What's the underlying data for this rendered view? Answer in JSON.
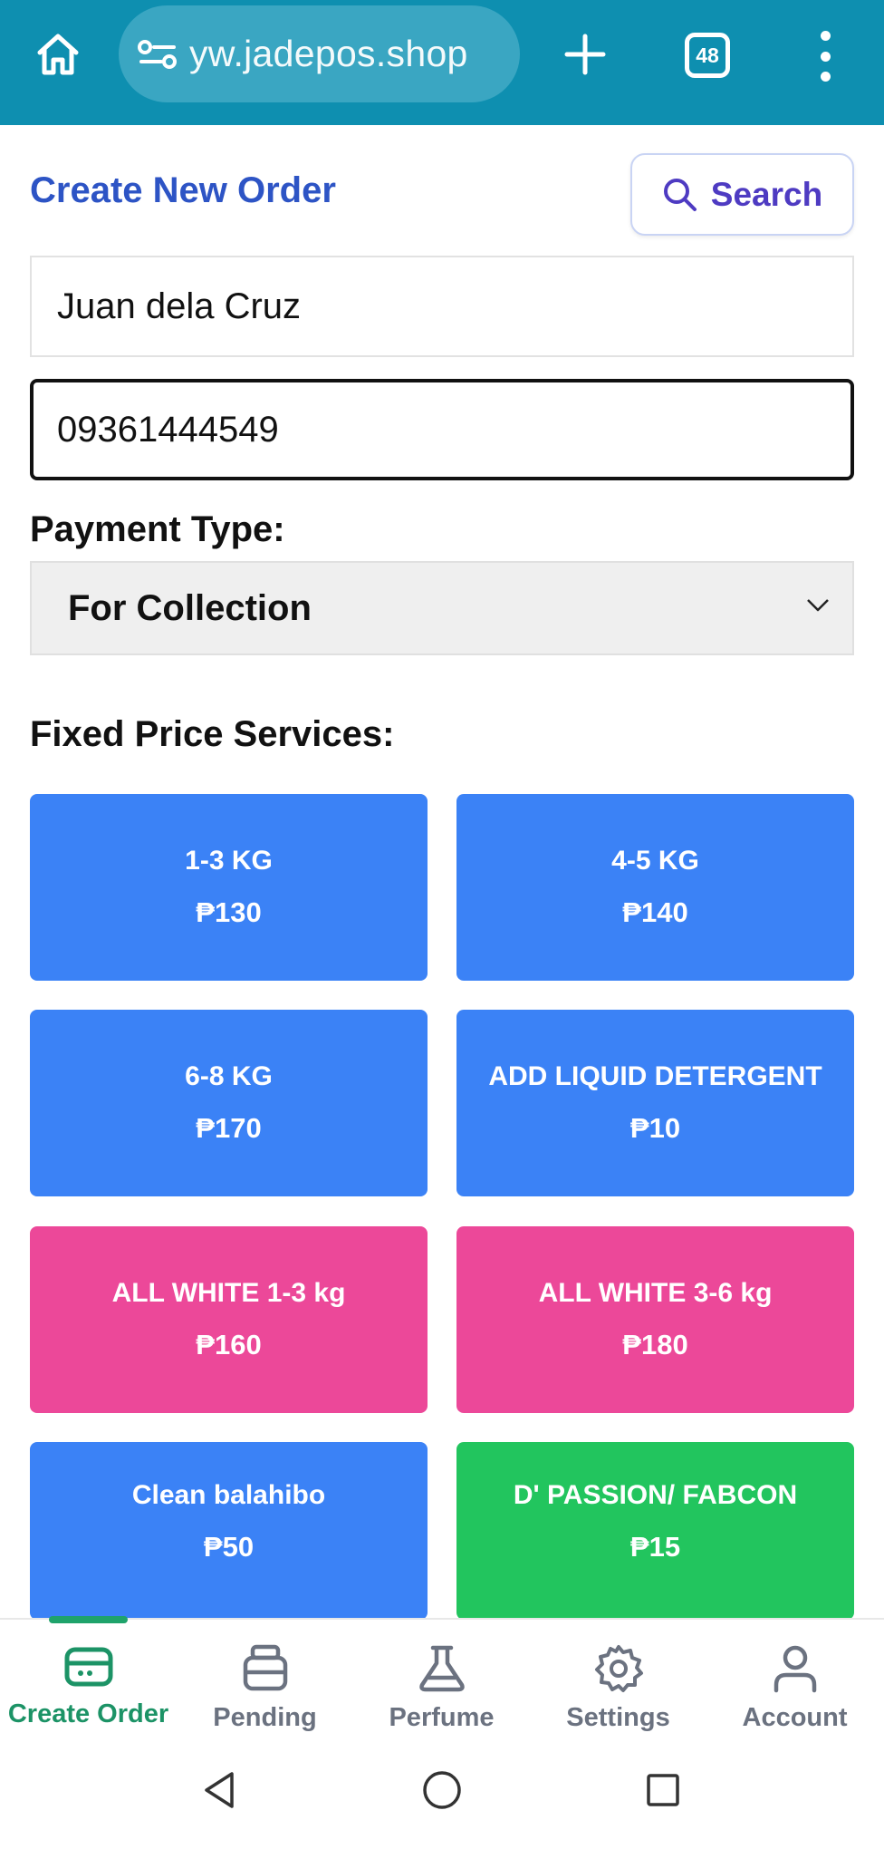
{
  "browser": {
    "url": "yw.jadepos.shop",
    "tab_count": "48",
    "icons": [
      "home-icon",
      "site-settings-icon",
      "new-tab-icon",
      "tabs-icon",
      "menu-icon"
    ],
    "bar_color": "#0e8fb0"
  },
  "header": {
    "title": "Create New Order",
    "search_label": "Search"
  },
  "form": {
    "customer_name": "Juan dela Cruz",
    "phone": "09361444549",
    "payment_label": "Payment Type:",
    "payment_value": "For Collection"
  },
  "services": {
    "label": "Fixed Price Services:",
    "items": [
      {
        "name": "1-3 KG",
        "price": "₱130",
        "color": "#3b82f6"
      },
      {
        "name": "4-5 KG",
        "price": "₱140",
        "color": "#3b82f6"
      },
      {
        "name": "6-8 KG",
        "price": "₱170",
        "color": "#3b82f6"
      },
      {
        "name": "ADD LIQUID DETERGENT",
        "price": "₱10",
        "color": "#3b82f6"
      },
      {
        "name": "ALL WHITE 1-3 kg",
        "price": "₱160",
        "color": "#ec4899"
      },
      {
        "name": "ALL WHITE 3-6 kg",
        "price": "₱180",
        "color": "#ec4899"
      },
      {
        "name": "Clean balahibo",
        "price": "₱50",
        "color": "#3b82f6"
      },
      {
        "name": "D' PASSION/ FABCON",
        "price": "₱15",
        "color": "#22c55e"
      }
    ]
  },
  "bottom_nav": {
    "items": [
      {
        "label": "Create Order",
        "icon": "card-icon",
        "active": true
      },
      {
        "label": "Pending",
        "icon": "basket-icon",
        "active": false
      },
      {
        "label": "Perfume",
        "icon": "flask-icon",
        "active": false
      },
      {
        "label": "Settings",
        "icon": "gear-icon",
        "active": false
      },
      {
        "label": "Account",
        "icon": "user-icon",
        "active": false
      }
    ],
    "active_color": "#1c9366"
  },
  "system_nav": {
    "icons": [
      "back-icon",
      "home-circle-icon",
      "recents-icon"
    ]
  }
}
